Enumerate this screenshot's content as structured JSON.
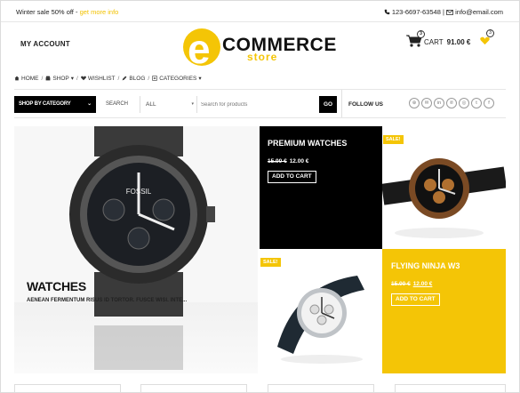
{
  "topbar": {
    "promo_text": "Winter sale 50% off - ",
    "promo_link": "get more info",
    "phone": "123-6697-63548",
    "email": "info@email.com"
  },
  "header": {
    "my_account": "MY ACCOUNT",
    "logo_e": "e",
    "logo_commerce": "COMMERCE",
    "logo_store": "store",
    "cart_label": "CART",
    "cart_total": "91.00 €",
    "cart_count": "3",
    "wishlist_count": "3"
  },
  "nav": {
    "items": [
      {
        "label": "HOME",
        "icon": "home-icon"
      },
      {
        "label": "SHOP",
        "icon": "shop-icon",
        "dropdown": true
      },
      {
        "label": "WISHLIST",
        "icon": "heart-icon"
      },
      {
        "label": "BLOG",
        "icon": "pencil-icon"
      },
      {
        "label": "CATEGORIES",
        "icon": "categories-icon",
        "dropdown": true
      }
    ]
  },
  "search": {
    "shop_by_category": "SHOP BY CATEGORY",
    "label": "SEARCH",
    "category_value": "ALL",
    "placeholder": "Search for products",
    "go": "GO"
  },
  "follow": {
    "label": "FOLLOW US",
    "socials": [
      "rss-icon",
      "mail-icon",
      "linkedin-icon",
      "pinterest-icon",
      "instagram-icon",
      "twitter-icon",
      "facebook-icon"
    ],
    "glyphs": [
      "⊛",
      "✉",
      "in",
      "℗",
      "◎",
      "t",
      "f"
    ]
  },
  "hero": {
    "title": "WATCHES",
    "subtitle": "AENEAN FERMENTUM RISUS ID TORTOR. FUSCE WISI. INTE...",
    "watch_brand": "FOSSIL"
  },
  "tiles": {
    "premium": {
      "title": "PREMIUM WATCHES",
      "old_price": "15.00 €",
      "new_price": "12.00 €",
      "button": "ADD TO CART"
    },
    "sale1": {
      "badge": "SALE!"
    },
    "sale2": {
      "badge": "SALE!"
    },
    "ninja": {
      "title": "FLYING NINJA W3",
      "old_price": "15.00 €",
      "new_price": "12.00 €",
      "button": "ADD TO CART"
    }
  },
  "colors": {
    "accent": "#f4c506",
    "dark": "#000000"
  }
}
